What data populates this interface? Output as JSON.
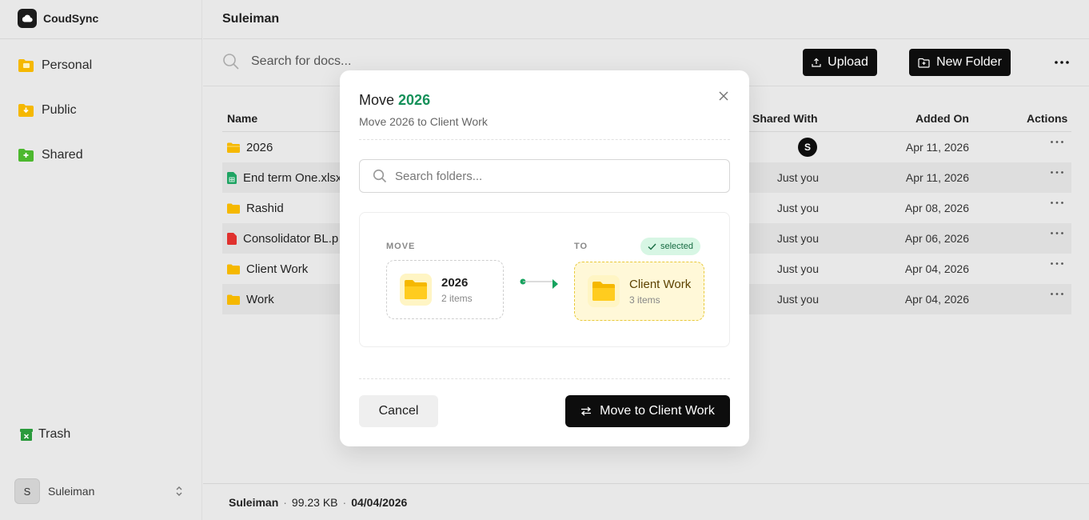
{
  "app": {
    "name": "CoudSync"
  },
  "sidebar": {
    "items": [
      {
        "label": "Personal",
        "icon": "folder-personal-icon"
      },
      {
        "label": "Public",
        "icon": "folder-public-icon"
      },
      {
        "label": "Shared",
        "icon": "folder-shared-icon"
      }
    ],
    "trash_label": "Trash",
    "user": {
      "initial": "S",
      "name": "Suleiman"
    }
  },
  "header": {
    "title": "Suleiman"
  },
  "toolbar": {
    "search_placeholder": "Search for docs...",
    "upload_label": "Upload",
    "new_folder_label": "New Folder"
  },
  "table": {
    "columns": {
      "name": "Name",
      "shared": "Shared With",
      "added": "Added On",
      "actions": "Actions"
    },
    "rows": [
      {
        "name": "2026",
        "type": "folder",
        "shared": "S",
        "added": "Apr 11, 2026"
      },
      {
        "name": "End term One.xlsx",
        "type": "xlsx",
        "shared": "Just you",
        "added": "Apr 11, 2026"
      },
      {
        "name": "Rashid",
        "type": "folder",
        "shared": "Just you",
        "added": "Apr 08, 2026"
      },
      {
        "name": "Consolidator BL.p",
        "type": "pdf",
        "shared": "Just you",
        "added": "Apr 06, 2026"
      },
      {
        "name": "Client Work",
        "type": "folder",
        "shared": "Just you",
        "added": "Apr 04, 2026"
      },
      {
        "name": "Work",
        "type": "folder",
        "shared": "Just you",
        "added": "Apr 04, 2026"
      }
    ]
  },
  "footer": {
    "owner": "Suleiman",
    "size": "99.23 KB",
    "date": "04/04/2026"
  },
  "modal": {
    "title_prefix": "Move ",
    "title_item": "2026",
    "subtitle": "Move 2026 to Client Work",
    "search_placeholder": "Search folders...",
    "move_label": "MOVE",
    "to_label": "TO",
    "selected_badge": "selected",
    "source": {
      "name": "2026",
      "meta": "2 items"
    },
    "destination": {
      "name": "Client Work",
      "meta": "3 items"
    },
    "cancel_label": "Cancel",
    "confirm_label": "Move to Client Work"
  },
  "colors": {
    "accent_green": "#16915a",
    "folder_yellow": "#f5c000",
    "dark_button": "#0d0d0d"
  }
}
